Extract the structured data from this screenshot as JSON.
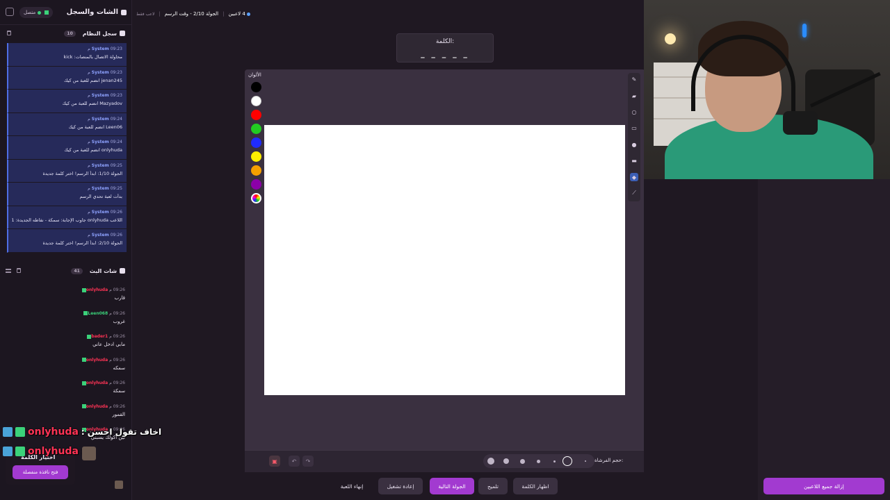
{
  "sidebar": {
    "title": "الشات والسجل",
    "status": "متصل",
    "system_log": {
      "title": "سجل النظام",
      "count": "10",
      "items": [
        {
          "sender": "System",
          "time": "09:23 م",
          "text": "محاولة الاتصال بالمنصات: kick"
        },
        {
          "sender": "System",
          "time": "09:23 م",
          "text": "jenan245 انضم للعبة من كيك"
        },
        {
          "sender": "System",
          "time": "09:23 م",
          "text": "Mazyadov انضم للعبة من كيك"
        },
        {
          "sender": "System",
          "time": "09:24 م",
          "text": "Leen06 انضم للعبة من كيك"
        },
        {
          "sender": "System",
          "time": "09:24 م",
          "text": "onlyhuda انضم للعبة من كيك"
        },
        {
          "sender": "System",
          "time": "09:25 م",
          "text": "الجولة 1/10: ابدأ الرسم! اختر كلمة جديدة"
        },
        {
          "sender": "System",
          "time": "09:25 م",
          "text": "بدأت لعبة تحدي الرسم"
        },
        {
          "sender": "System",
          "time": "09:26 م",
          "text": "اللاعب onlyhuda جاوب الإجابة: سمكة - نقاطه الجديدة: 1"
        },
        {
          "sender": "System",
          "time": "09:26 م",
          "text": "الجولة 2/10: ابدأ الرسم! اختر كلمة جديدة"
        }
      ]
    },
    "chat": {
      "title": "شات البث",
      "count": "41",
      "items": [
        {
          "user": "onlyhuda",
          "user_color": "#ff3355",
          "time": "09:26 م",
          "text": "قارب"
        },
        {
          "user": "Leen068",
          "user_color": "#3bd27a",
          "time": "09:26 م",
          "text": "غروب"
        },
        {
          "user": "bader1",
          "user_color": "#ff3355",
          "time": "09:26 م",
          "text": "مابي ادخل عاني"
        },
        {
          "user": "onlyhuda",
          "user_color": "#ff3355",
          "time": "09:26 م",
          "text": "سمكه"
        },
        {
          "user": "onlyhuda",
          "user_color": "#ff3355",
          "time": "09:26 م",
          "text": "سمكة"
        },
        {
          "user": "onlyhuda",
          "user_color": "#ff3355",
          "time": "09:26 م",
          "text": "القمور"
        },
        {
          "user": "onlyhuda",
          "user_color": "#ff3355",
          "time": "09:26 م",
          "text": "لين اكولك يسبني"
        }
      ]
    },
    "pick_word": {
      "title": "اختيار الكلمة",
      "button": "فتح نافذة منفصلة"
    }
  },
  "overlays": [
    {
      "user": "onlyhuda",
      "text": "اخاف تقول احسن"
    },
    {
      "user": "onlyhuda",
      "text": ""
    }
  ],
  "topbar": {
    "players": "4 لاعبين",
    "round": "الجولة 2/10 - وقت الرسم",
    "note": "لاعب فقط"
  },
  "word": {
    "label": "الكلمة:",
    "mask": "_ _ _ _ _"
  },
  "board": {
    "colors_label": "الألوان",
    "colors": [
      "#000000",
      "#ffffff",
      "#ff0000",
      "#22cc22",
      "#1f2bff",
      "#ffee00",
      "#f5a000",
      "#8b00a8"
    ],
    "brush_label": "حجم الفرشاة:"
  },
  "buttons": {
    "end_game": "إنهاء اللعبة",
    "restart": "إعادة تشغيل",
    "next_round": "الجولة التالية",
    "hint": "تلميح",
    "show_word": "اظهار الكلمة",
    "remove_players": "إزالة جميع اللاعبين"
  }
}
